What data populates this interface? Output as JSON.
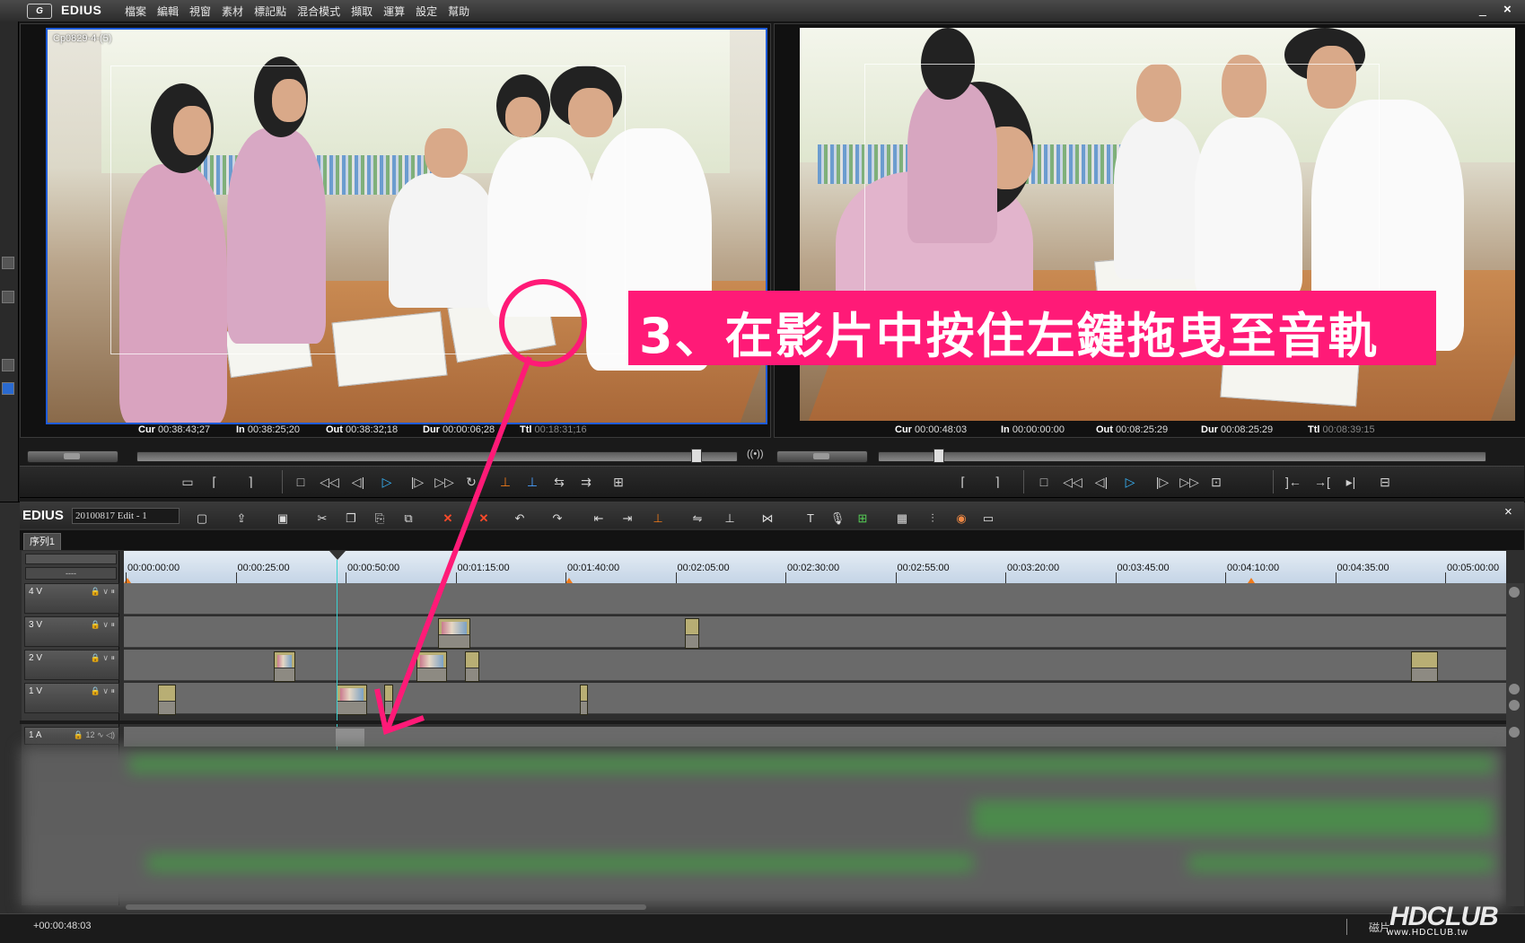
{
  "app": {
    "logo": "G",
    "name": "EDIUS"
  },
  "menu": [
    "檔案",
    "編輯",
    "視窗",
    "素材",
    "標記點",
    "混合模式",
    "擷取",
    "運算",
    "設定",
    "幫助"
  ],
  "window_controls": {
    "minimize": "_",
    "close": "×"
  },
  "player": {
    "clip_name": "Cp0829-4-(5)",
    "cur_label": "Cur",
    "cur": "00:38:43;27",
    "in_label": "In",
    "in": "00:38:25;20",
    "out_label": "Out",
    "out": "00:38:32;18",
    "dur_label": "Dur",
    "dur": "00:00:06;28",
    "ttl_label": "Ttl",
    "ttl": "00:18:31;16"
  },
  "recorder": {
    "cur_label": "Cur",
    "cur": "00:00:48:03",
    "in_label": "In",
    "in": "00:00:00:00",
    "out_label": "Out",
    "out": "00:08:25:29",
    "dur_label": "Dur",
    "dur": "00:08:25:29",
    "ttl_label": "Ttl",
    "ttl": "00:08:39:15"
  },
  "timeline": {
    "brand": "EDIUS",
    "project": "20100817 Edit - 1",
    "close": "×",
    "sequence_tab": "序列1",
    "ruler_labels": [
      "00:00:00:00",
      "00:00:25:00",
      "00:00:50:00",
      "00:01:15:00",
      "00:01:40:00",
      "00:02:05:00",
      "00:02:30:00",
      "00:02:55:00",
      "00:03:20:00",
      "00:03:45:00",
      "00:04:10:00",
      "00:04:35:00",
      "00:05:00:00"
    ],
    "tracks": [
      {
        "name": "4 V"
      },
      {
        "name": "3 V"
      },
      {
        "name": "2 V"
      },
      {
        "name": "1 V"
      }
    ],
    "audio_track": {
      "name": "1 A",
      "vol": "12"
    },
    "timeline_scale": "----"
  },
  "status": {
    "timecode": "+00:00:48:03",
    "right_text": "磁片"
  },
  "watermark": {
    "logo": "HDCLUB",
    "url": "www.HDCLUB.tw"
  },
  "annotation": {
    "text": "3、在影片中按住左鍵拖曳至音軌",
    "color": "#ff1a77"
  },
  "colors": {
    "accent_blue": "#1e5bd8",
    "play_blue": "#38b8ff",
    "playhead": "#3ad0d0",
    "clip": "#b8ae74",
    "ruler": "#c4d4e6"
  }
}
